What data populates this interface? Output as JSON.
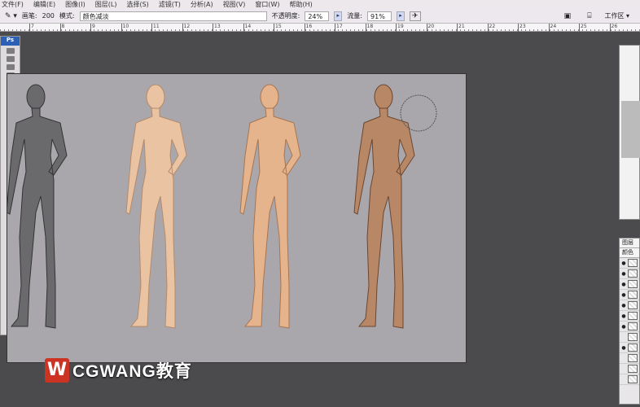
{
  "menu": [
    "文件(F)",
    "编辑(E)",
    "图像(I)",
    "图层(L)",
    "选择(S)",
    "滤镜(T)",
    "分析(A)",
    "视图(V)",
    "窗口(W)",
    "帮助(H)"
  ],
  "options": {
    "brush_label": "画笔:",
    "brush_size": "200",
    "mode_label": "模式:",
    "mode_value": "颜色减淡",
    "opacity_label": "不透明度:",
    "opacity_value": "24%",
    "flow_label": "流量:",
    "flow_value": "91%",
    "workspace": "工作区 ▾"
  },
  "ruler": [
    "7",
    "8",
    "9",
    "10",
    "11",
    "12",
    "13",
    "14",
    "15",
    "16",
    "17",
    "18",
    "19",
    "20",
    "21",
    "22",
    "23",
    "24",
    "25",
    "26"
  ],
  "toolbox": {
    "logo": "Ps"
  },
  "layers": {
    "tab": "图层",
    "blend": "颜色",
    "rows": [
      true,
      true,
      true,
      true,
      true,
      true,
      true,
      false,
      true,
      false,
      false,
      false
    ]
  },
  "watermark": {
    "mark": "W",
    "text": "CGWANG教育"
  },
  "colors": {
    "canvas": "#a9a7ac",
    "background": "#4b4a4d",
    "skin": "#e8bc98",
    "skin_dark": "#9a6a4c",
    "sketch": "#6a6a6c"
  }
}
